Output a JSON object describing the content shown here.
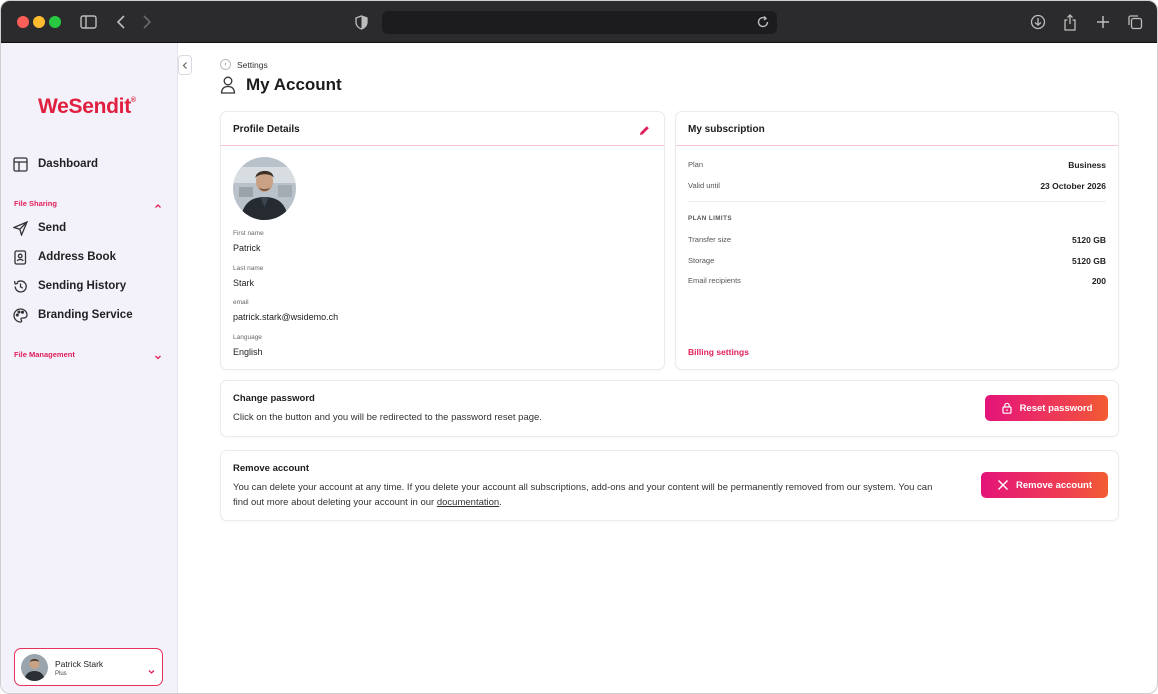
{
  "browser": {
    "url": ""
  },
  "sidebar": {
    "logo": "WeSendit",
    "logo_mark": "®",
    "items": [
      {
        "label": "Dashboard",
        "icon": "dashboard-icon"
      },
      {
        "label": "Send",
        "icon": "send-icon"
      },
      {
        "label": "Address Book",
        "icon": "address-book-icon"
      },
      {
        "label": "Sending History",
        "icon": "history-icon"
      },
      {
        "label": "Branding Service",
        "icon": "palette-icon"
      }
    ],
    "sections": {
      "file_sharing": "File Sharing",
      "file_management": "File Management"
    },
    "user": {
      "name": "Patrick Stark",
      "plan": "Plus"
    }
  },
  "breadcrumb": {
    "label": "Settings"
  },
  "page": {
    "title": "My Account"
  },
  "profile": {
    "title": "Profile Details",
    "fields": [
      {
        "label": "First name",
        "value": "Patrick"
      },
      {
        "label": "Last name",
        "value": "Stark"
      },
      {
        "label": "email",
        "value": "patrick.stark@wsidemo.ch"
      },
      {
        "label": "Language",
        "value": "English"
      }
    ]
  },
  "subscription": {
    "title": "My subscription",
    "plan_label": "Plan",
    "plan_value": "Business",
    "valid_label": "Valid until",
    "valid_value": "23 October 2026",
    "limits_heading": "PLAN LIMITS",
    "limits": [
      {
        "label": "Transfer size",
        "value": "5120 GB"
      },
      {
        "label": "Storage",
        "value": "5120 GB"
      },
      {
        "label": "Email recipients",
        "value": "200"
      }
    ],
    "billing_link": "Billing settings"
  },
  "change_password": {
    "title": "Change password",
    "description": "Click on the button and you will be redirected to the password reset page.",
    "button": "Reset password"
  },
  "remove_account": {
    "title": "Remove account",
    "description_line1": "You can delete your account at any time. If you delete your account all subscriptions, add-ons and your content will be permanently removed from our system. You can",
    "description_line2": "find out more about deleting your account in our",
    "link": "documentation",
    "period": ".",
    "button": "Remove account"
  },
  "colors": {
    "brand": "#e0203e",
    "accent": "#e0205a",
    "sidebar_bg": "#f3f2fb"
  }
}
